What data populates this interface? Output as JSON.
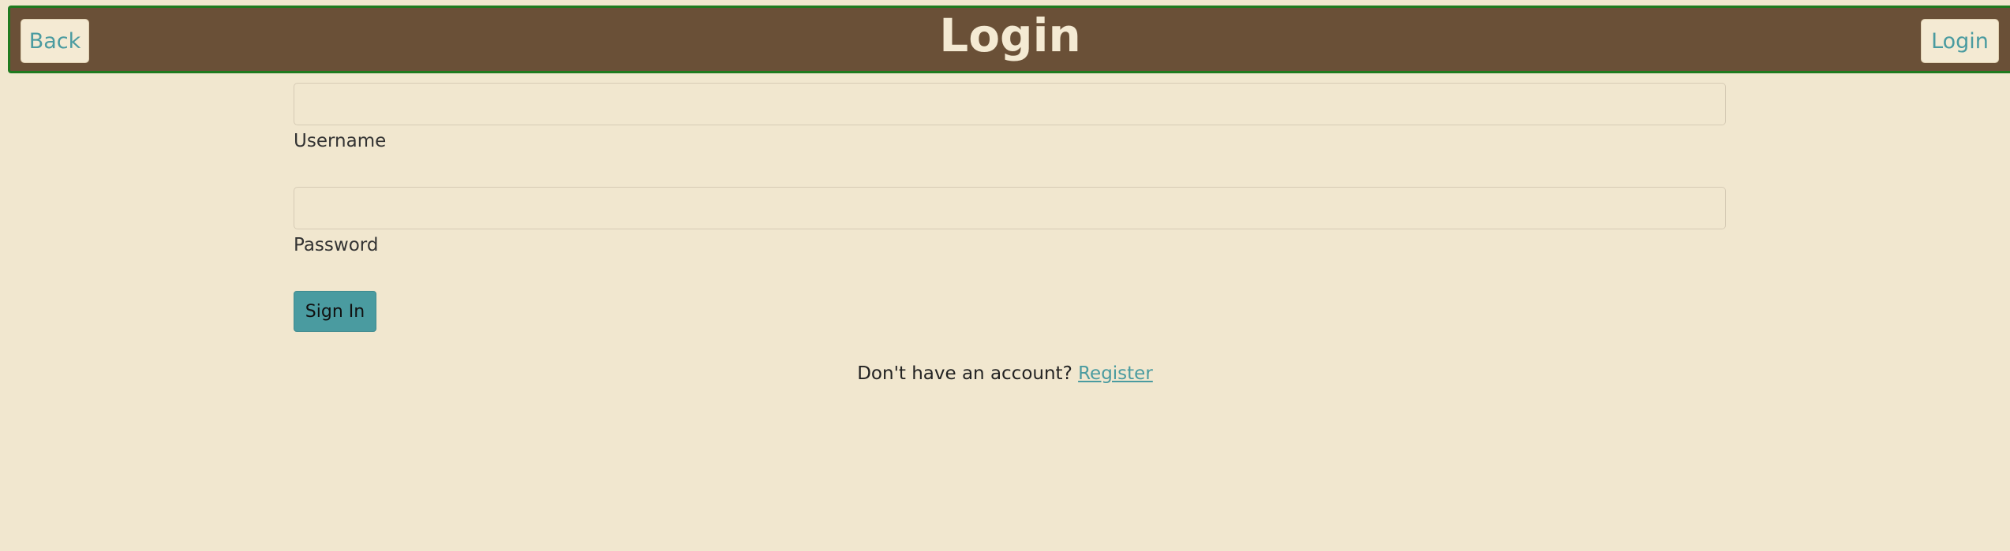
{
  "header": {
    "title": "Login",
    "back_label": "Back",
    "login_label": "Login"
  },
  "form": {
    "username": {
      "label": "Username",
      "value": "",
      "placeholder": ""
    },
    "password": {
      "label": "Password",
      "value": "",
      "placeholder": ""
    },
    "submit_label": "Sign In"
  },
  "footer": {
    "prompt": "Don't have an account?",
    "register_label": "Register"
  },
  "colors": {
    "background": "#f1e7cf",
    "header_bg": "#6a5037",
    "header_border": "#1f7a1f",
    "accent": "#4a9ba0",
    "header_text": "#f4ead3"
  }
}
